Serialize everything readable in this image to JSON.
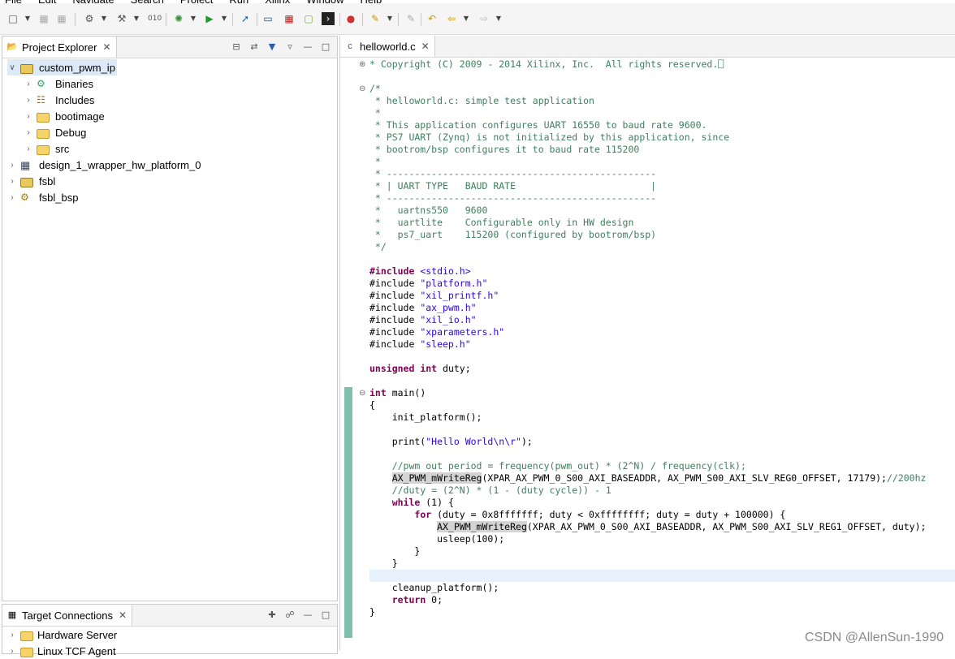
{
  "menu": [
    "File",
    "Edit",
    "Navigate",
    "Search",
    "Project",
    "Run",
    "Xilinx",
    "Window",
    "Help"
  ],
  "project_explorer": {
    "title": "Project Explorer",
    "items": [
      {
        "label": "custom_pwm_ip",
        "depth": 0,
        "expanded": true,
        "icon": "open-project-icon",
        "selected": true
      },
      {
        "label": "Binaries",
        "depth": 1,
        "icon": "binaries-icon"
      },
      {
        "label": "Includes",
        "depth": 1,
        "icon": "includes-icon"
      },
      {
        "label": "bootimage",
        "depth": 1,
        "icon": "folder-icon"
      },
      {
        "label": "Debug",
        "depth": 1,
        "icon": "folder-icon"
      },
      {
        "label": "src",
        "depth": 1,
        "icon": "folder-icon"
      },
      {
        "label": "design_1_wrapper_hw_platform_0",
        "depth": 0,
        "icon": "hw-platform-icon"
      },
      {
        "label": "fsbl",
        "depth": 0,
        "icon": "project-icon"
      },
      {
        "label": "fsbl_bsp",
        "depth": 0,
        "icon": "bsp-icon"
      }
    ]
  },
  "target_connections": {
    "title": "Target Connections",
    "items": [
      {
        "label": "Hardware Server"
      },
      {
        "label": "Linux TCF Agent"
      }
    ]
  },
  "editor": {
    "tab": "helloworld.c",
    "lines": [
      "* Copyright (C) 2009 - 2014 Xilinx, Inc.  All rights reserved.⎕",
      "",
      "/*",
      " * helloworld.c: simple test application",
      " *",
      " * This application configures UART 16550 to baud rate 9600.",
      " * PS7 UART (Zynq) is not initialized by this application, since",
      " * bootrom/bsp configures it to baud rate 115200",
      " *",
      " * ------------------------------------------------",
      " * | UART TYPE   BAUD RATE                        |",
      " * ------------------------------------------------",
      " *   uartns550   9600",
      " *   uartlite    Configurable only in HW design",
      " *   ps7_uart    115200 (configured by bootrom/bsp)",
      " */",
      "",
      "#include <stdio.h>",
      "#include \"platform.h\"",
      "#include \"xil_printf.h\"",
      "#include \"ax_pwm.h\"",
      "#include \"xil_io.h\"",
      "#include \"xparameters.h\"",
      "#include \"sleep.h\"",
      "",
      "unsigned int duty;",
      "",
      "int main()",
      "{",
      "    init_platform();",
      "",
      "    print(\"Hello World\\n\\r\");",
      "",
      "    //pwm out period = frequency(pwm_out) * (2^N) / frequency(clk);",
      "    AX_PWM_mWriteReg(XPAR_AX_PWM_0_S00_AXI_BASEADDR, AX_PWM_S00_AXI_SLV_REG0_OFFSET, 17179);//200hz",
      "    //duty = (2^N) * (1 - (duty cycle)) - 1",
      "    while (1) {",
      "        for (duty = 0x8fffffff; duty < 0xffffffff; duty = duty + 100000) {",
      "            AX_PWM_mWriteReg(XPAR_AX_PWM_0_S00_AXI_BASEADDR, AX_PWM_S00_AXI_SLV_REG1_OFFSET, duty);",
      "            usleep(100);",
      "        }",
      "    }",
      "",
      "    cleanup_platform();",
      "    return 0;",
      "}"
    ]
  },
  "watermark": "CSDN @AllenSun-1990"
}
